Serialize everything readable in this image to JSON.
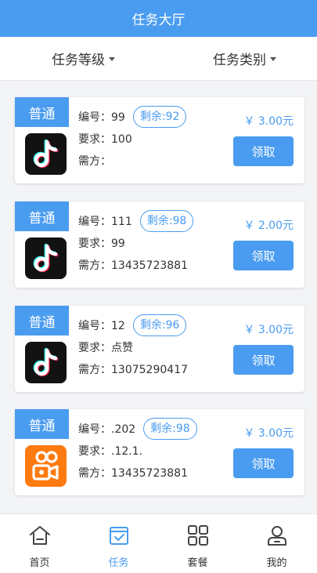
{
  "header": {
    "title": "任务大厅"
  },
  "filters": {
    "level": "任务等级",
    "category": "任务类别"
  },
  "tasks": [
    {
      "tag": "普通",
      "id": "编号：99",
      "remaining": "剩余:92",
      "req": "要求：100",
      "buyer": "需方：",
      "price": "￥ 3.00元",
      "action": "领取",
      "app_icon": "tiktok-icon"
    },
    {
      "tag": "普通",
      "id": "编号：111",
      "remaining": "剩余:98",
      "req": "要求：99",
      "buyer": "需方：13435723881",
      "price": "￥ 2.00元",
      "action": "领取",
      "app_icon": "tiktok-icon"
    },
    {
      "tag": "普通",
      "id": "编号：12",
      "remaining": "剩余:96",
      "req": "要求：点赞",
      "buyer": "需方：13075290417",
      "price": "￥ 3.00元",
      "action": "领取",
      "app_icon": "tiktok-icon"
    },
    {
      "tag": "普通",
      "id": "编号：.202",
      "remaining": "剩余:98",
      "req": "要求：.12.1.",
      "buyer": "需方：13435723881",
      "price": "￥ 3.00元",
      "action": "领取",
      "app_icon": "kuaishou-icon"
    }
  ],
  "tabbar": [
    {
      "label": "首页",
      "icon": "home-icon",
      "active": false
    },
    {
      "label": "任务",
      "icon": "task-icon",
      "active": true
    },
    {
      "label": "套餐",
      "icon": "grid-icon",
      "active": false
    },
    {
      "label": "我的",
      "icon": "user-icon",
      "active": false
    }
  ],
  "colors": {
    "accent": "#4a9cf0",
    "background": "#f3f4f6"
  }
}
